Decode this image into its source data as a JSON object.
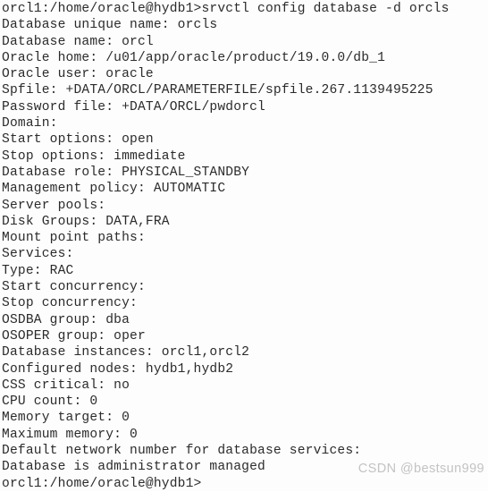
{
  "terminal": {
    "prompt": "orcl1:/home/oracle@hydb1>",
    "command": "srvctl config database -d orcls",
    "lines": [
      "orcl1:/home/oracle@hydb1>srvctl config database -d orcls",
      "Database unique name: orcls",
      "Database name: orcl",
      "Oracle home: /u01/app/oracle/product/19.0.0/db_1",
      "Oracle user: oracle",
      "Spfile: +DATA/ORCL/PARAMETERFILE/spfile.267.1139495225",
      "Password file: +DATA/ORCL/pwdorcl",
      "Domain:",
      "Start options: open",
      "Stop options: immediate",
      "Database role: PHYSICAL_STANDBY",
      "Management policy: AUTOMATIC",
      "Server pools:",
      "Disk Groups: DATA,FRA",
      "Mount point paths:",
      "Services:",
      "Type: RAC",
      "Start concurrency:",
      "Stop concurrency:",
      "OSDBA group: dba",
      "OSOPER group: oper",
      "Database instances: orcl1,orcl2",
      "Configured nodes: hydb1,hydb2",
      "CSS critical: no",
      "CPU count: 0",
      "Memory target: 0",
      "Maximum memory: 0",
      "Default network number for database services:",
      "Database is administrator managed",
      "orcl1:/home/oracle@hydb1>"
    ],
    "fields": {
      "database_unique_name": "orcls",
      "database_name": "orcl",
      "oracle_home": "/u01/app/oracle/product/19.0.0/db_1",
      "oracle_user": "oracle",
      "spfile": "+DATA/ORCL/PARAMETERFILE/spfile.267.1139495225",
      "password_file": "+DATA/ORCL/pwdorcl",
      "domain": "",
      "start_options": "open",
      "stop_options": "immediate",
      "database_role": "PHYSICAL_STANDBY",
      "management_policy": "AUTOMATIC",
      "server_pools": "",
      "disk_groups": "DATA,FRA",
      "mount_point_paths": "",
      "services": "",
      "type": "RAC",
      "start_concurrency": "",
      "stop_concurrency": "",
      "osdba_group": "dba",
      "osoper_group": "oper",
      "database_instances": "orcl1,orcl2",
      "configured_nodes": "hydb1,hydb2",
      "css_critical": "no",
      "cpu_count": "0",
      "memory_target": "0",
      "maximum_memory": "0",
      "default_network_number_for_database_services": "",
      "management_note": "Database is administrator managed"
    }
  },
  "watermark": {
    "text": "CSDN @bestsun999"
  },
  "colors": {
    "background": "#fdfdfd",
    "text": "#2b2b2b",
    "watermark": "#c3c3c3"
  }
}
